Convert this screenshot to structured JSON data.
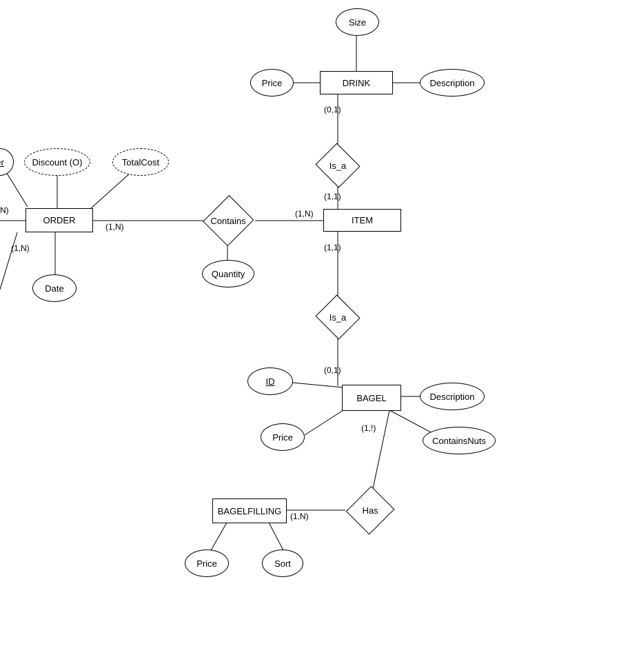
{
  "entities": {
    "drink": "DRINK",
    "order": "ORDER",
    "item": "ITEM",
    "bagel": "BAGEL",
    "bagelfilling": "BAGELFILLING"
  },
  "attributes": {
    "size": "Size",
    "price_drink": "Price",
    "description_drink": "Description",
    "discount_o": "Discount (O)",
    "totalcost": "TotalCost",
    "order_pk_frag": "er",
    "date": "Date",
    "quantity": "Quantity",
    "id_bagel": "ID",
    "description_bagel": "Description",
    "price_bagel": "Price",
    "containsnuts": "ContainsNuts",
    "price_fill": "Price",
    "sort": "Sort"
  },
  "relationships": {
    "is_a_top": "Is_a",
    "contains": "Contains",
    "is_a_mid": "Is_a",
    "has": "Has"
  },
  "cardinalities": {
    "drink_isa": "(0,1)",
    "item_isa_top": "(1,1)",
    "order_left_n": "N)",
    "order_contains": "(1,N)",
    "order_below": "(1,N)",
    "item_contains": "(1,N)",
    "item_isa_mid": "(1,1)",
    "bagel_isa": "(0,1)",
    "bagel_has": "(1,!)",
    "fill_has": "(1,N)"
  }
}
